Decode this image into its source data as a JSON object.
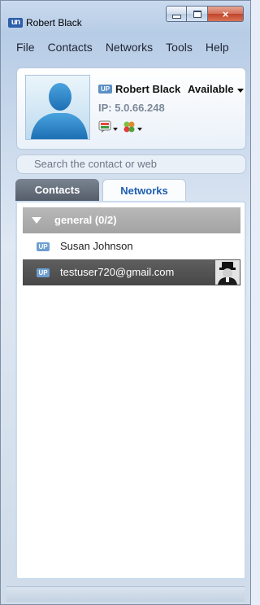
{
  "window": {
    "title": "Robert Black",
    "app_icon": "app-logo-icon",
    "close_glyph": "×"
  },
  "menu": {
    "items": [
      "File",
      "Contacts",
      "Networks",
      "Tools",
      "Help"
    ]
  },
  "profile": {
    "name": "Robert Black",
    "status": "Available",
    "ip_label": "IP: 5.0.66.248",
    "badge": "UP"
  },
  "search": {
    "placeholder": "Search the contact or web"
  },
  "tabs": [
    {
      "label": "Contacts",
      "active": true
    },
    {
      "label": "Networks",
      "active": false
    }
  ],
  "contacts": {
    "group": {
      "label": "general (0/2)",
      "expanded": true
    },
    "items": [
      {
        "name": "Susan Johnson",
        "selected": false,
        "badge": "UP"
      },
      {
        "name": "testuser720@gmail.com",
        "selected": true,
        "badge": "UP"
      }
    ]
  },
  "colors": {
    "accent": "#1f5fb0",
    "selected_row": "#4f4f4f",
    "group_header": "#adadad"
  }
}
